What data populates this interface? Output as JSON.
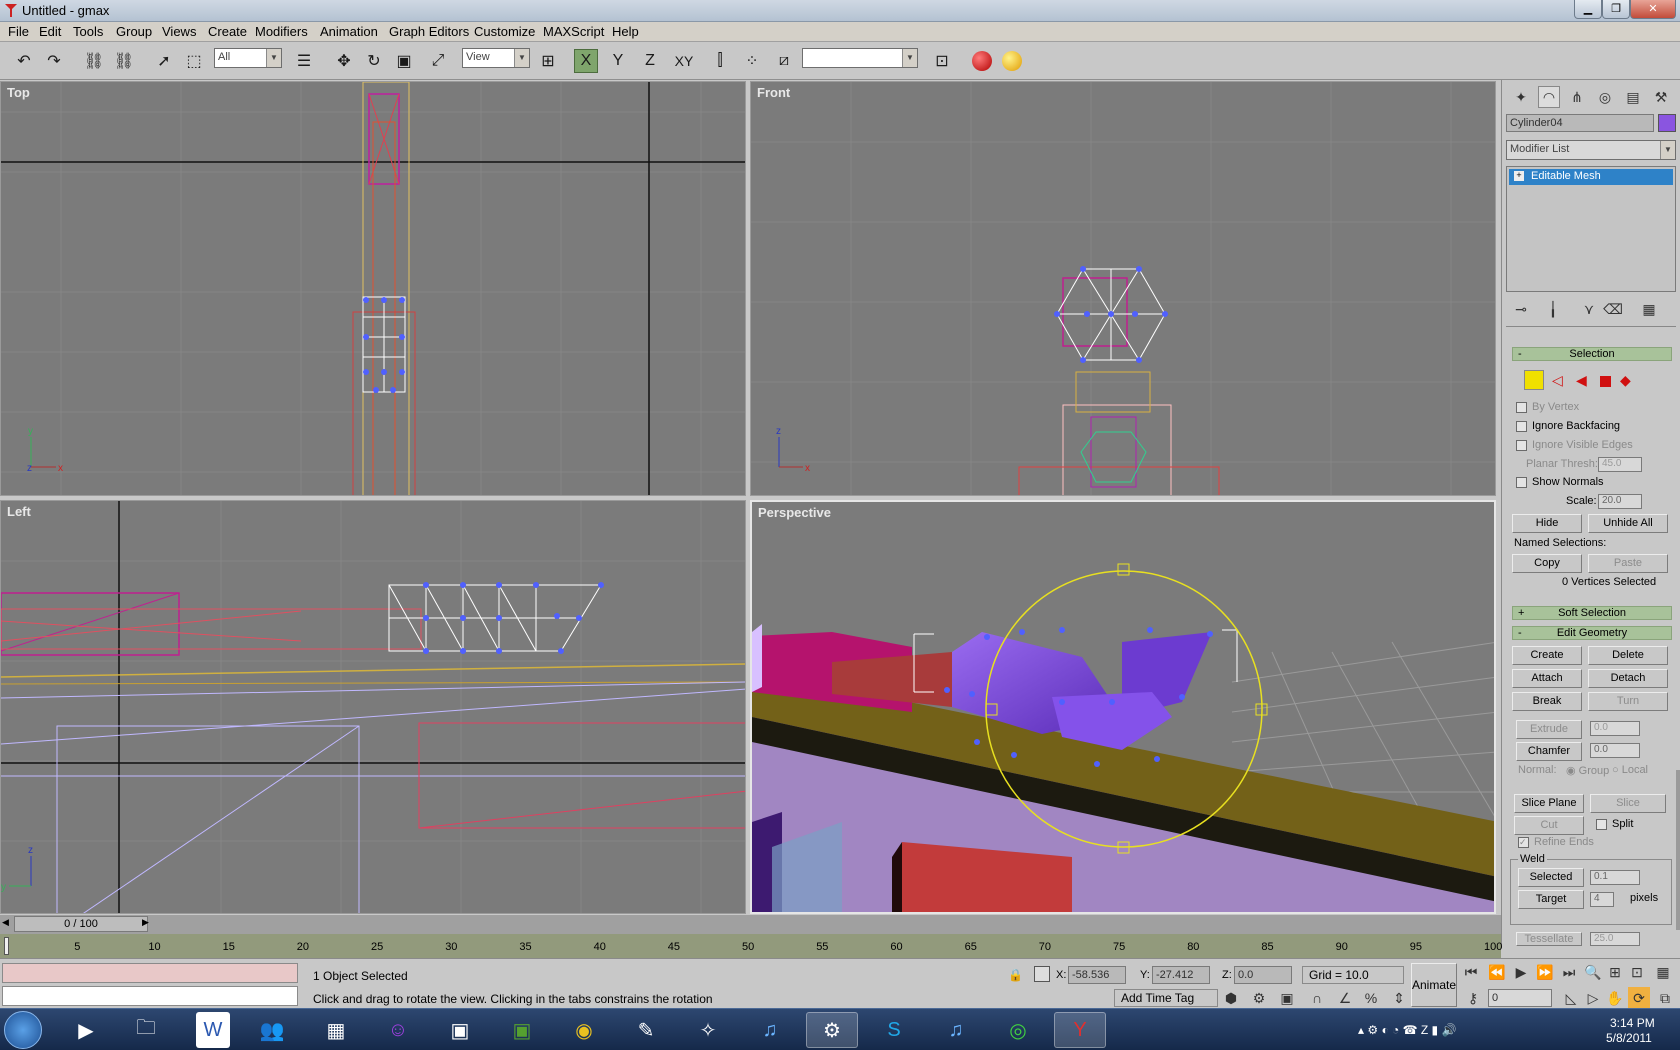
{
  "window": {
    "title": "Untitled - gmax"
  },
  "menu": [
    "File",
    "Edit",
    "Tools",
    "Group",
    "Views",
    "Create",
    "Modifiers",
    "Animation",
    "Graph Editors",
    "Customize",
    "MAXScript",
    "Help"
  ],
  "toolbar": {
    "filter_value": "All",
    "coord_value": "View",
    "axis_x": "X",
    "axis_y": "Y",
    "axis_z": "Z",
    "axis_xy": "XY",
    "named_sel": ""
  },
  "viewports": {
    "top": "Top",
    "front": "Front",
    "left": "Left",
    "perspective": "Perspective"
  },
  "panel": {
    "object_name": "Cylinder04",
    "object_color": "#8a55e0",
    "modifier_list": "Modifier List",
    "stack_item": "Editable Mesh",
    "selection": {
      "title": "Selection",
      "by_vertex": "By Vertex",
      "ignore_backfacing": "Ignore Backfacing",
      "ignore_visible_edges": "Ignore Visible Edges",
      "planar_thresh_label": "Planar Thresh:",
      "planar_thresh": "45.0",
      "show_normals": "Show Normals",
      "scale_label": "Scale:",
      "scale": "20.0",
      "hide": "Hide",
      "unhide_all": "Unhide All",
      "named_selections": "Named Selections:",
      "copy": "Copy",
      "paste": "Paste",
      "status": "0 Vertices Selected"
    },
    "soft_selection": "Soft Selection",
    "edit_geometry": {
      "title": "Edit Geometry",
      "create": "Create",
      "delete": "Delete",
      "attach": "Attach",
      "detach": "Detach",
      "break": "Break",
      "turn": "Turn",
      "extrude": "Extrude",
      "extrude_val": "0.0",
      "chamfer": "Chamfer",
      "chamfer_val": "0.0",
      "normal": "Normal:",
      "group": "Group",
      "local": "Local",
      "slice_plane": "Slice Plane",
      "slice": "Slice",
      "cut": "Cut",
      "split": "Split",
      "refine_ends": "Refine Ends",
      "weld": "Weld",
      "selected": "Selected",
      "selected_val": "0.1",
      "target": "Target",
      "target_val": "4",
      "pixels": "pixels",
      "tessellate": "Tessellate",
      "tessellate_val": "25.0"
    }
  },
  "time": {
    "slider": "0 / 100",
    "ticks": [
      "5",
      "10",
      "15",
      "20",
      "25",
      "30",
      "35",
      "40",
      "45",
      "50",
      "55",
      "60",
      "65",
      "70",
      "75",
      "80",
      "85",
      "90",
      "95",
      "100"
    ]
  },
  "status": {
    "selection": "1 Object Selected",
    "prompt": "Click and drag to rotate the view.  Clicking in the tabs constrains the rotation",
    "x_label": "X:",
    "x": "-58.536",
    "y_label": "Y:",
    "y": "-27.412",
    "z_label": "Z:",
    "z": "0.0",
    "grid": "Grid = 10.0",
    "add_time_tag": "Add Time Tag",
    "animate": "Animate",
    "frame": "0"
  },
  "taskbar": {
    "time": "3:14 PM",
    "date": "5/8/2011"
  },
  "colors": {
    "viewport_bg": "#7b7b7b",
    "rollout": "#a8c29a",
    "selection_purple": "#7a4ad8"
  }
}
